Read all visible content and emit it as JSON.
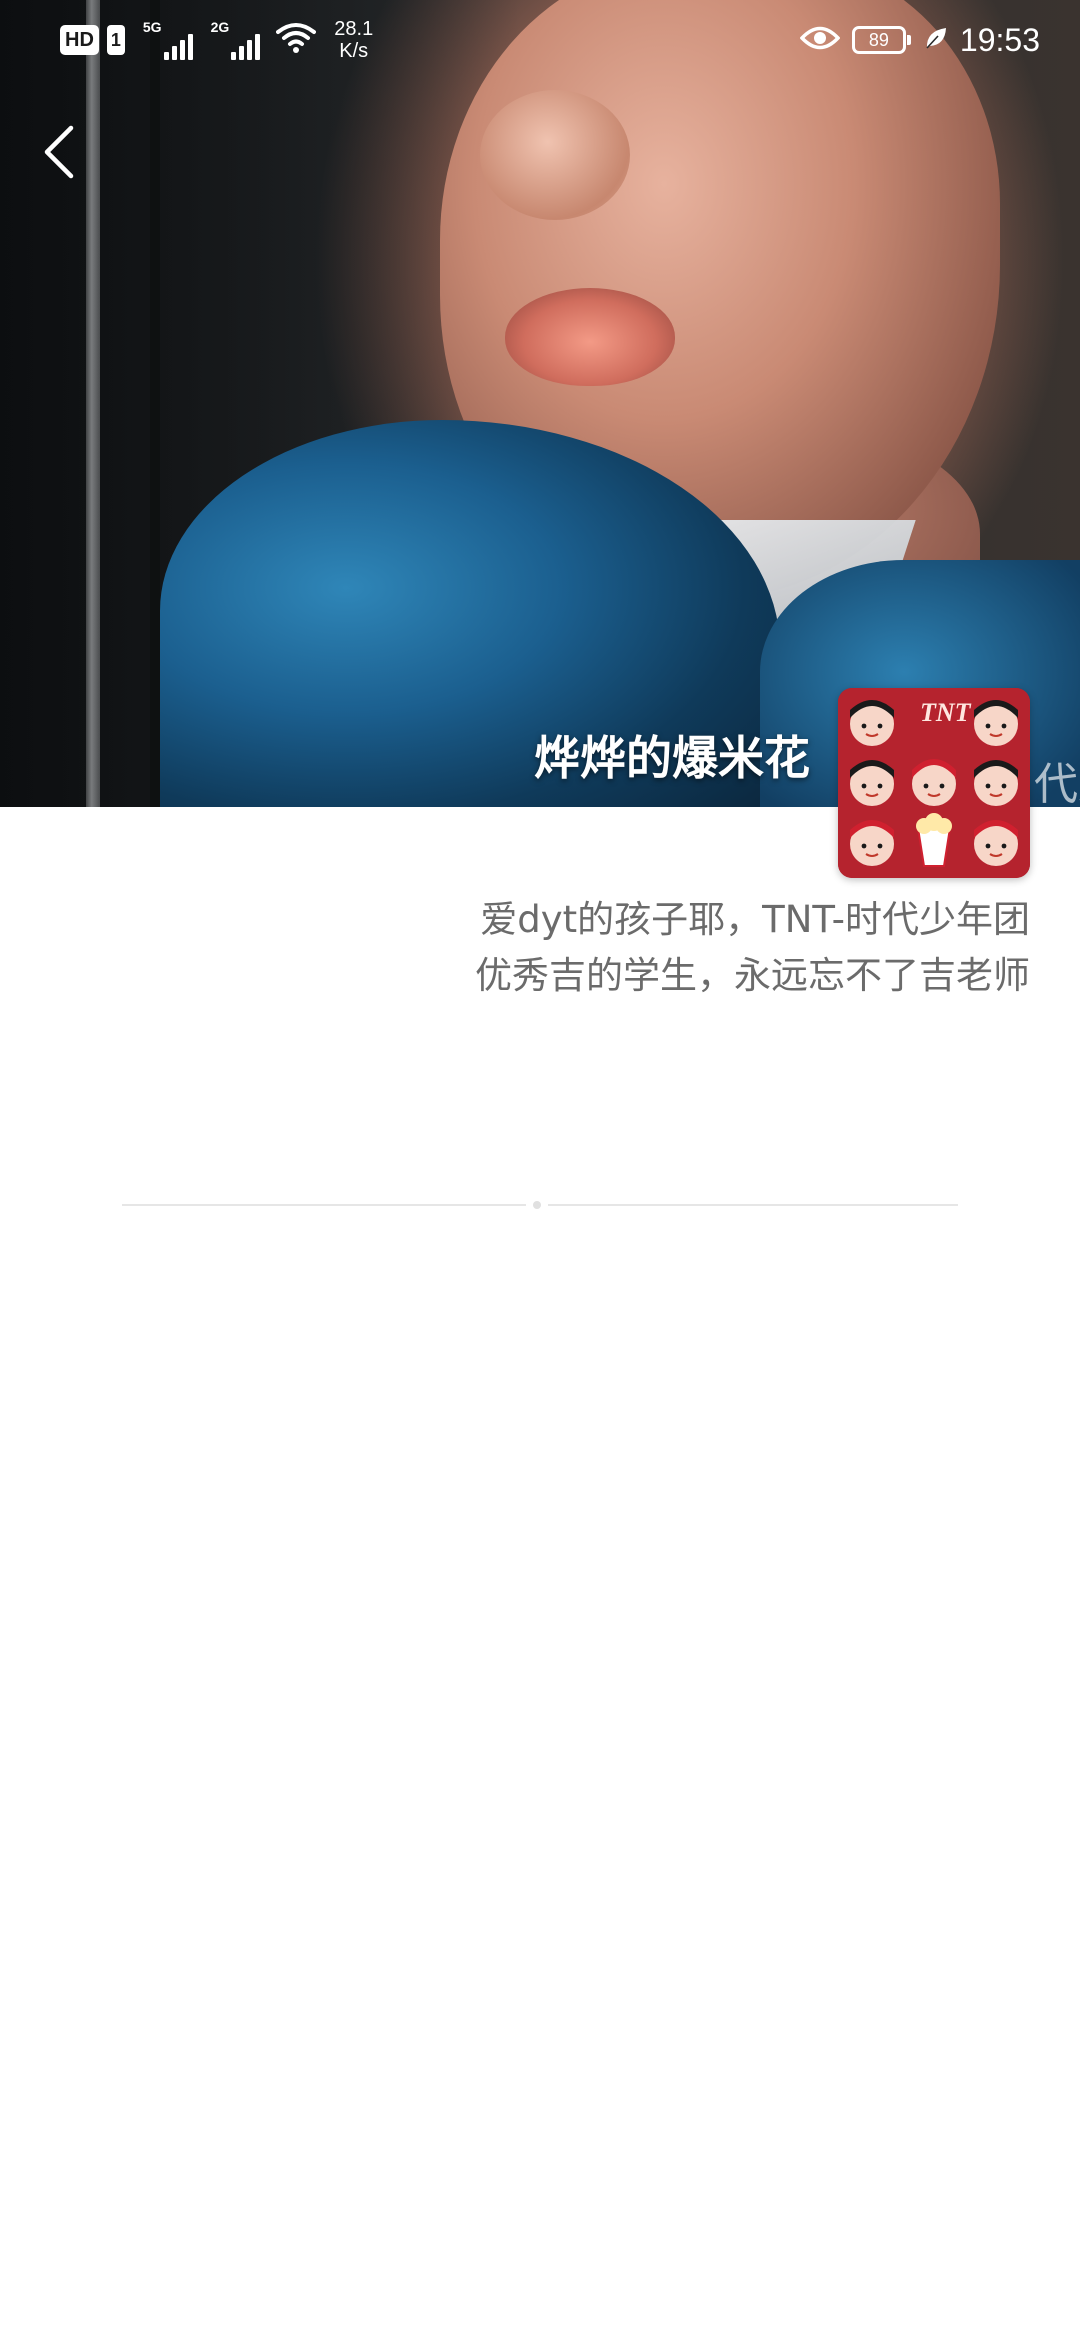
{
  "status_bar": {
    "hd": "HD",
    "sim": "1",
    "network_1": "5G",
    "network_2": "2G",
    "speed_value": "28.1",
    "speed_unit": "K/s",
    "battery": "89",
    "time": "19:53",
    "icons": [
      "hd-icon",
      "signal-icon",
      "wifi-icon",
      "eye-icon",
      "battery-icon",
      "leaf-icon"
    ]
  },
  "header": {
    "back_icon": "chevron-left-icon"
  },
  "profile": {
    "name": "烨烨的爆米花",
    "name_overflow": "代少",
    "avatar_text": "TNT",
    "bio_line1": "爱dyt的孩子耶，TNT-时代少年团",
    "bio_line2": "优秀吉的学生，永远忘不了吉老师"
  },
  "colors": {
    "bio_text": "#6b6b6b",
    "avatar_bg": "#b5232e",
    "divider": "#e6e6e6"
  }
}
